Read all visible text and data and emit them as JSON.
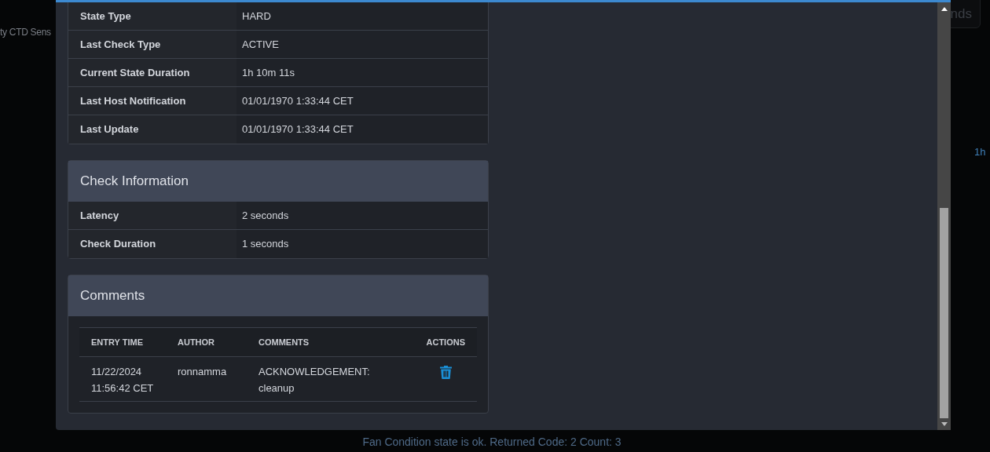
{
  "background": {
    "page_title_fragment": "ty CTD Sens",
    "button_fragment": "nds",
    "time_fragment": "1h",
    "status_message": "Fan Condition state is ok. Returned Code: 2 Count: 3"
  },
  "modal": {
    "state_rows": [
      {
        "label": "State Type",
        "value": "HARD"
      },
      {
        "label": "Last Check Type",
        "value": "ACTIVE"
      },
      {
        "label": "Current State Duration",
        "value": "1h 10m 11s"
      },
      {
        "label": "Last Host Notification",
        "value": "01/01/1970 1:33:44 CET"
      },
      {
        "label": "Last Update",
        "value": "01/01/1970 1:33:44 CET"
      }
    ],
    "check_information": {
      "title": "Check Information",
      "rows": [
        {
          "label": "Latency",
          "value": "2 seconds"
        },
        {
          "label": "Check Duration",
          "value": "1 seconds"
        }
      ]
    },
    "comments": {
      "title": "Comments",
      "columns": [
        "ENTRY TIME",
        "AUTHOR",
        "COMMENTS",
        "ACTIONS"
      ],
      "rows": [
        {
          "entry_time": "11/22/2024 11:56:42 CET",
          "author": "ronnamma",
          "comment": "ACKNOWLEDGEMENT: cleanup"
        }
      ]
    }
  }
}
